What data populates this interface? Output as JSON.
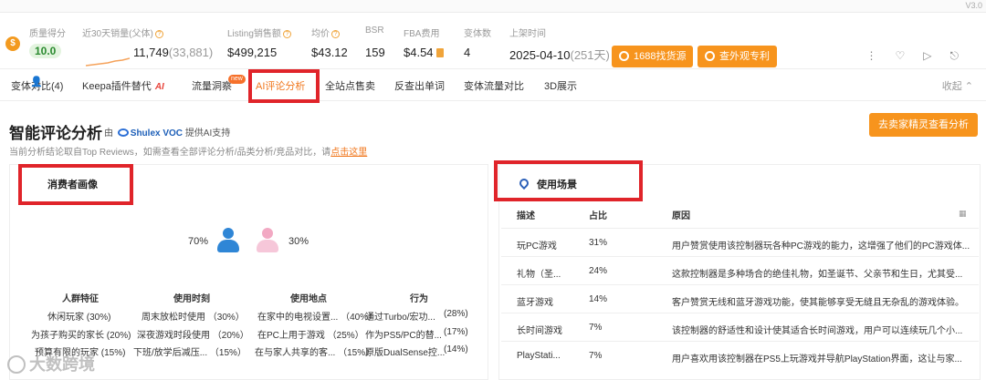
{
  "version": "V3.0",
  "stats": {
    "quality": {
      "label": "质量得分",
      "value": "10.0"
    },
    "sales30": {
      "label": "近30天销量(父体)",
      "value": "11,749",
      "sub": "(33,881)"
    },
    "listing_sales": {
      "label": "Listing销售额",
      "value": "$499,215"
    },
    "price": {
      "label": "均价",
      "value": "$43.12"
    },
    "bsr": {
      "label": "BSR",
      "value": "159"
    },
    "fba": {
      "label": "FBA费用",
      "value": "$4.54"
    },
    "variants": {
      "label": "变体数",
      "value": "4"
    },
    "launch": {
      "label": "上架时间",
      "value": "2025-04-10",
      "sub": "(251天)"
    },
    "btn_1688": "1688找货源",
    "btn_patent": "查外观专利"
  },
  "tabs": {
    "items": [
      "变体对比(4)",
      "Keepa插件替代",
      "流量洞察",
      "AI评论分析",
      "全站点售卖",
      "反查出单词",
      "变体流量对比",
      "3D展示"
    ],
    "ai_mark": "AI",
    "new_badge": "new",
    "collapse": "收起"
  },
  "header": {
    "title": "智能评论分析",
    "by_prefix": "由",
    "brand": "Shulex VOC",
    "by_suffix": "提供AI支持",
    "subtitle": "当前分析结论取自Top Reviews，如需查看全部评论分析/品类分析/竞品对比，请",
    "subtitle_link": "点击这里",
    "analyze_button": "去卖家精灵查看分析"
  },
  "consumer": {
    "title": "消费者画像",
    "male_pct": "70%",
    "female_pct": "30%",
    "columns": [
      "人群特征",
      "使用时刻",
      "使用地点",
      "行为"
    ],
    "rows": [
      [
        "休闲玩家 (30%)",
        "周末放松时使用 （30%）",
        "在家中的电视设置... （40%）",
        "通过Turbo/宏功...",
        "(28%)"
      ],
      [
        "为孩子购买的家长 (20%)",
        "深夜游戏时段使用 （20%）",
        "在PC上用于游戏 （25%）",
        "作为PS5/PC的替...",
        "(17%)"
      ],
      [
        "预算有限的玩家 (15%)",
        "下班/放学后减压... （15%）",
        "在与家人共享的客... （15%）",
        "原版DualSense控...",
        "(14%)"
      ]
    ]
  },
  "scenario": {
    "title": "使用场景",
    "columns": [
      "描述",
      "占比",
      "原因"
    ],
    "rows": [
      {
        "desc": "玩PC游戏",
        "ratio": "31%",
        "reason": "用户赞赏使用该控制器玩各种PC游戏的能力，这增强了他们的PC游戏体..."
      },
      {
        "desc": "礼物（圣...",
        "ratio": "24%",
        "reason": "这款控制器是多种场合的绝佳礼物，如圣诞节、父亲节和生日，尤其受..."
      },
      {
        "desc": "蓝牙游戏",
        "ratio": "14%",
        "reason": "客户赞赏无线和蓝牙游戏功能，使其能够享受无缝且无杂乱的游戏体验。"
      },
      {
        "desc": "长时间游戏",
        "ratio": "7%",
        "reason": "该控制器的舒适性和设计使其适合长时间游戏，用户可以连续玩几个小..."
      },
      {
        "desc": "PlayStati...",
        "ratio": "7%",
        "reason": "用户喜欢用该控制器在PS5上玩游戏并导航PlayStation界面，这让与家..."
      }
    ]
  },
  "watermark": "大数跨境"
}
